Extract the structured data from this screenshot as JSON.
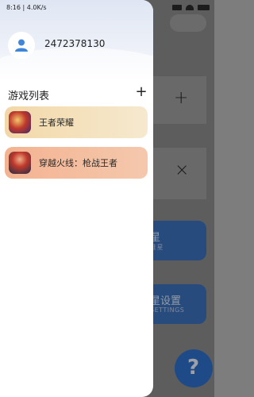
{
  "status_bar": {
    "text": "8:16 | 4.0K/s"
  },
  "user": {
    "id": "2472378130"
  },
  "game_list": {
    "title": "游戏列表",
    "add_symbol": "+",
    "items": [
      {
        "name": "王者荣耀",
        "gradient_start": "#f2d8a8",
        "gradient_end": "#f6e9cf",
        "icon": "honor-of-kings-icon"
      },
      {
        "name": "穿越火线：枪战王者",
        "gradient_start": "#f3b391",
        "gradient_end": "#f5c8ad",
        "icon": "crossfire-icon"
      }
    ]
  },
  "background_app": {
    "plus_symbol": "+",
    "close_symbol": "×",
    "tile1": {
      "title": "星",
      "subtitle": "准星"
    },
    "tile2": {
      "title": "星设置",
      "subtitle": "SETTINGS"
    }
  }
}
